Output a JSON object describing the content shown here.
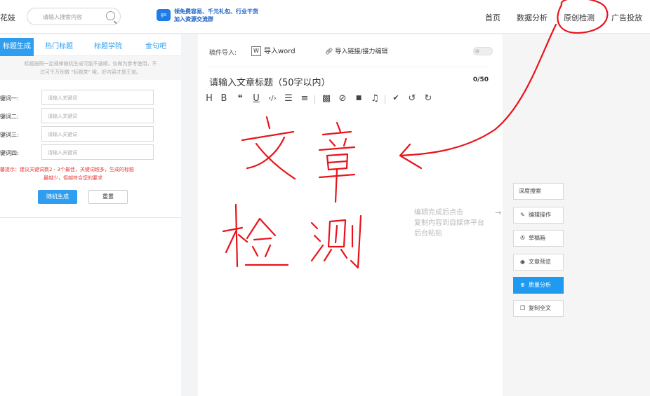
{
  "header": {
    "logo_text": "花妓",
    "search_placeholder": "请输入搜索内容",
    "promo_icon": "go",
    "promo_line1": "领免费容易、千元礼包、行业干货",
    "promo_line2": "加入资源交流群",
    "nav": [
      "首页",
      "数据分析",
      "原创检测",
      "广告投放"
    ]
  },
  "left": {
    "tabs": [
      "标题生成",
      "热门标题",
      "标题学院",
      "金句吧"
    ],
    "tip_line1": "标题按照一定规律随机生成可能不通顺，仅做为参考使用，不",
    "tip_line2": "过可千万别做 \"标题党\" 哦，好内容才是王道。",
    "keywords": [
      {
        "label": "键词一:",
        "placeholder": "请输入关键词"
      },
      {
        "label": "键词二:",
        "placeholder": "请输入关键词"
      },
      {
        "label": "键词三:",
        "placeholder": "请输入关键词"
      },
      {
        "label": "键词四:",
        "placeholder": "请输入关键词"
      }
    ],
    "warn_line1": "馨提示：建议关键词数2 - 3个最佳，关键词越多，生成的标题",
    "warn_line2": "最越少，但越符合您的要求",
    "generate_label": "随机生成",
    "reset_label": "重置"
  },
  "editor": {
    "import_label": "稿件导入:",
    "word_icon": "W",
    "word_label": "导入word",
    "link_label": "导入链接/接力编辑",
    "title_placeholder": "请输入文章标题（50字以内）",
    "title_count": "0/50",
    "toolbar": [
      "H",
      "B",
      "❝",
      "U",
      "‹/›",
      "☰",
      "≡",
      "▩",
      "⊘",
      "■",
      "♫",
      "✔",
      "↺",
      "↻"
    ]
  },
  "right": {
    "hint_lines": [
      "编辑完成后点击",
      "复制内容到自媒体平台",
      "后台粘贴"
    ],
    "hint_arrow": "→",
    "buttons": [
      {
        "icon": "",
        "label": "深度搜索"
      },
      {
        "icon": "✎",
        "label": "编辑操作"
      },
      {
        "icon": "✇",
        "label": "草稿箱"
      },
      {
        "icon": "◉",
        "label": "文章预览"
      },
      {
        "icon": "⊕",
        "label": "质量分析"
      },
      {
        "icon": "❐",
        "label": "复制全文"
      }
    ]
  },
  "annotation_color": "#e8141c"
}
